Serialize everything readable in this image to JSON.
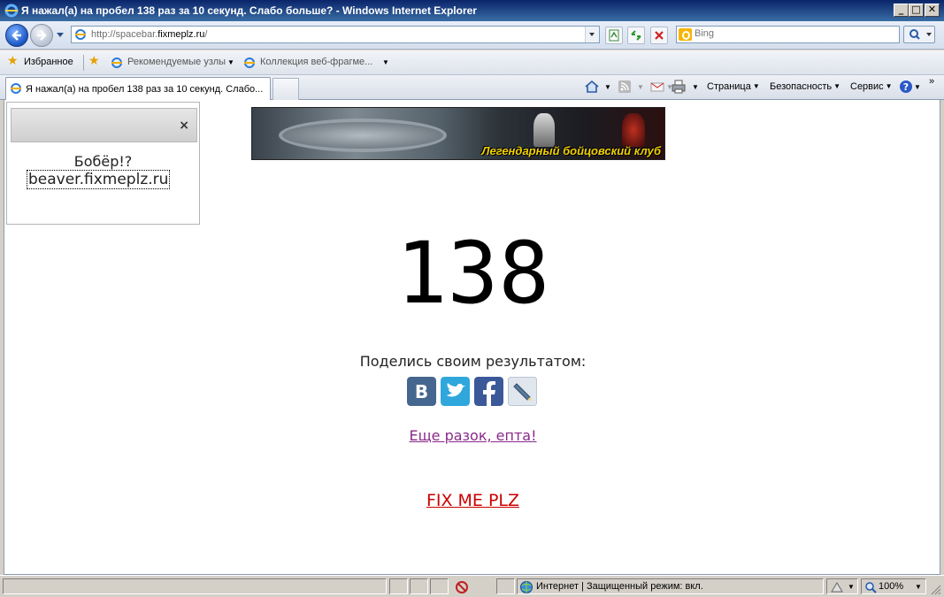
{
  "window": {
    "title": "Я нажал(а) на пробел 138 раз за 10 секунд. Слабо больше? - Windows Internet Explorer",
    "minimize": "_",
    "maximize": "□",
    "close": "✕"
  },
  "navbar": {
    "url_prefix": "http://spacebar.",
    "url_domain": "fixmeplz.ru",
    "url_suffix": "/",
    "search_placeholder": "Bing"
  },
  "favorites": {
    "label": "Избранное",
    "items": [
      "Рекомендуемые узлы",
      "Коллекция веб-фрагме..."
    ]
  },
  "tab": {
    "label": "Я нажал(а) на пробел 138 раз за 10 секунд. Слабо..."
  },
  "commands": {
    "page": "Страница",
    "safety": "Безопасность",
    "tools": "Сервис"
  },
  "side_panel": {
    "close": "×",
    "question": "Бобёр!?",
    "link": "beaver.fixmeplz.ru"
  },
  "banner": {
    "text": "Легендарный бойцовский клуб"
  },
  "content": {
    "score": "138",
    "share_label": "Поделись своим результатом:",
    "again_link": "Еще разок, епта!",
    "fixme_link": "FIX ME PLZ"
  },
  "share_icons": [
    {
      "name": "vk-icon",
      "color": "#45668e"
    },
    {
      "name": "twitter-icon",
      "color": "#2fa7dd"
    },
    {
      "name": "facebook-icon",
      "color": "#3b5998"
    },
    {
      "name": "livejournal-icon",
      "color": "#dfe6ee"
    }
  ],
  "statusbar": {
    "zone": "Интернет | Защищенный режим: вкл.",
    "zoom": "100%"
  }
}
